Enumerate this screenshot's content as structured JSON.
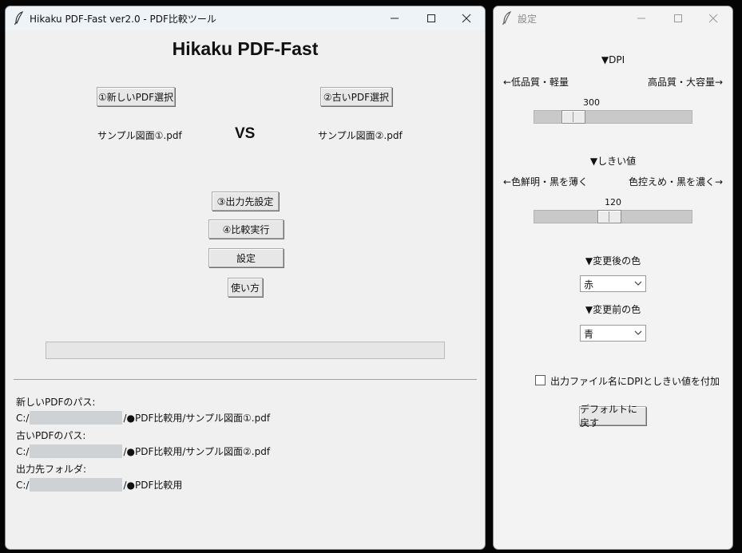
{
  "main_window": {
    "title": "Hikaku PDF-Fast ver2.0 - PDF比較ツール",
    "min_glyph": "—",
    "max_glyph": "☐",
    "close_glyph": "✕",
    "app_title": "Hikaku PDF-Fast",
    "select_new_button": "①新しいPDF選択",
    "select_old_button": "②古いPDF選択",
    "new_file_label": "サンプル図面①.pdf",
    "old_file_label": "サンプル図面②.pdf",
    "vs_label": "VS",
    "output_dest_button": "③出力先設定",
    "run_compare_button": "④比較実行",
    "settings_button": "設定",
    "howto_button": "使い方",
    "progress": 0,
    "paths": {
      "new_label": "新しいPDFのパス:",
      "new_prefix": "C:/",
      "new_suffix": "/●PDF比較用/サンプル図面①.pdf",
      "old_label": "古いPDFのパス:",
      "old_prefix": "C:/",
      "old_suffix": "/●PDF比較用/サンプル図面②.pdf",
      "out_label": "出力先フォルダ:",
      "out_prefix": "C:/",
      "out_suffix": "/●PDF比較用"
    }
  },
  "settings_window": {
    "title": "設定",
    "min_glyph": "—",
    "max_glyph": "☐",
    "close_glyph": "✕",
    "dpi": {
      "heading": "▼DPI",
      "left_hint": "←低品質・軽量",
      "right_hint": "高品質・大容量→",
      "value": 300,
      "value_text": "300",
      "min": 72,
      "max": 1200
    },
    "threshold": {
      "heading": "▼しきい値",
      "left_hint": "←色鮮明・黒を薄く",
      "right_hint": "色控えめ・黒を濃く→",
      "value": 120,
      "value_text": "120",
      "min": 0,
      "max": 255
    },
    "after_color": {
      "heading": "▼変更後の色",
      "selected": "赤"
    },
    "before_color": {
      "heading": "▼変更前の色",
      "selected": "青"
    },
    "append_checkbox": {
      "label": "出力ファイル名にDPIとしきい値を付加",
      "checked": false
    },
    "reset_button": "デフォルトに戻す"
  },
  "colors": {
    "window_bg": "#f0f0f0",
    "titlebar_active": "#eef3f8",
    "button_face": "#e7e7e7",
    "slider_trough": "#c9c9c9",
    "redaction": "#cfd2d5"
  },
  "icons": {
    "app_icon": "feather-icon",
    "settings_app_icon": "feather-icon",
    "combo_arrow": "chevron-down-icon"
  }
}
